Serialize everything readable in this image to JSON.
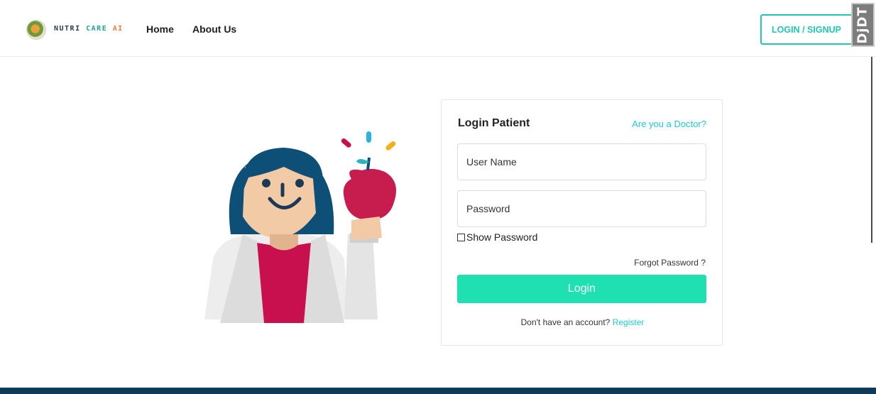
{
  "header": {
    "brand": {
      "part1": "NUTRI",
      "part2": "CARE",
      "part3": "AI"
    },
    "nav": [
      {
        "label": "Home"
      },
      {
        "label": "About Us"
      }
    ],
    "login_signup_label": "LOGIN / SIGNUP",
    "debug_toolbar_label": "DjDT"
  },
  "login_card": {
    "title": "Login Patient",
    "doctor_link": "Are you a Doctor?",
    "username_placeholder": "User Name",
    "password_placeholder": "Password",
    "show_password_label": "Show Password",
    "forgot_password": "Forgot Password ?",
    "login_button": "Login",
    "no_account_text": "Don't have an account?",
    "register_link": "Register"
  },
  "colors": {
    "accent_teal": "#22c9b0",
    "login_button": "#1ee0b0",
    "link_cyan": "#22c9d4",
    "footer": "#0f3b5a"
  },
  "icons": {
    "logo": "nutri-care-logo-icon",
    "illustration": "doctor-with-apple-illustration"
  }
}
